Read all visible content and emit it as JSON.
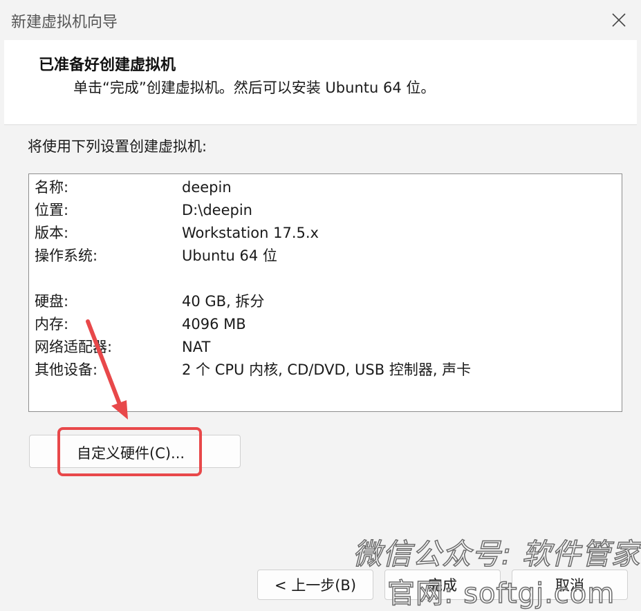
{
  "window": {
    "title": "新建虚拟机向导"
  },
  "header": {
    "title": "已准备好创建虚拟机",
    "subtitle": "单击“完成”创建虚拟机。然后可以安装 Ubuntu 64 位。"
  },
  "intro": "将使用下列设置创建虚拟机:",
  "summary": [
    {
      "key": "名称:",
      "value": "deepin"
    },
    {
      "key": "位置:",
      "value": "D:\\deepin"
    },
    {
      "key": "版本:",
      "value": "Workstation 17.5.x"
    },
    {
      "key": "操作系统:",
      "value": "Ubuntu 64 位"
    },
    {
      "key": "硬盘:",
      "value": "40 GB, 拆分"
    },
    {
      "key": "内存:",
      "value": "4096 MB"
    },
    {
      "key": "网络适配器:",
      "value": "NAT"
    },
    {
      "key": "其他设备:",
      "value": "2 个 CPU 内核, CD/DVD, USB 控制器, 声卡"
    }
  ],
  "buttons": {
    "customize": "自定义硬件(C)...",
    "back": "< 上一步(B)",
    "finish": "完成",
    "cancel": "取消"
  },
  "watermark": {
    "line1": "微信公众号: 软件管家",
    "line2": "官网: softgj.com"
  },
  "colors": {
    "highlight": "#e8484a",
    "header_bg": "#ffffff",
    "window_bg": "#f3f3f3"
  },
  "icons": {
    "close": "close-icon",
    "annotation": "red-arrow-icon"
  }
}
